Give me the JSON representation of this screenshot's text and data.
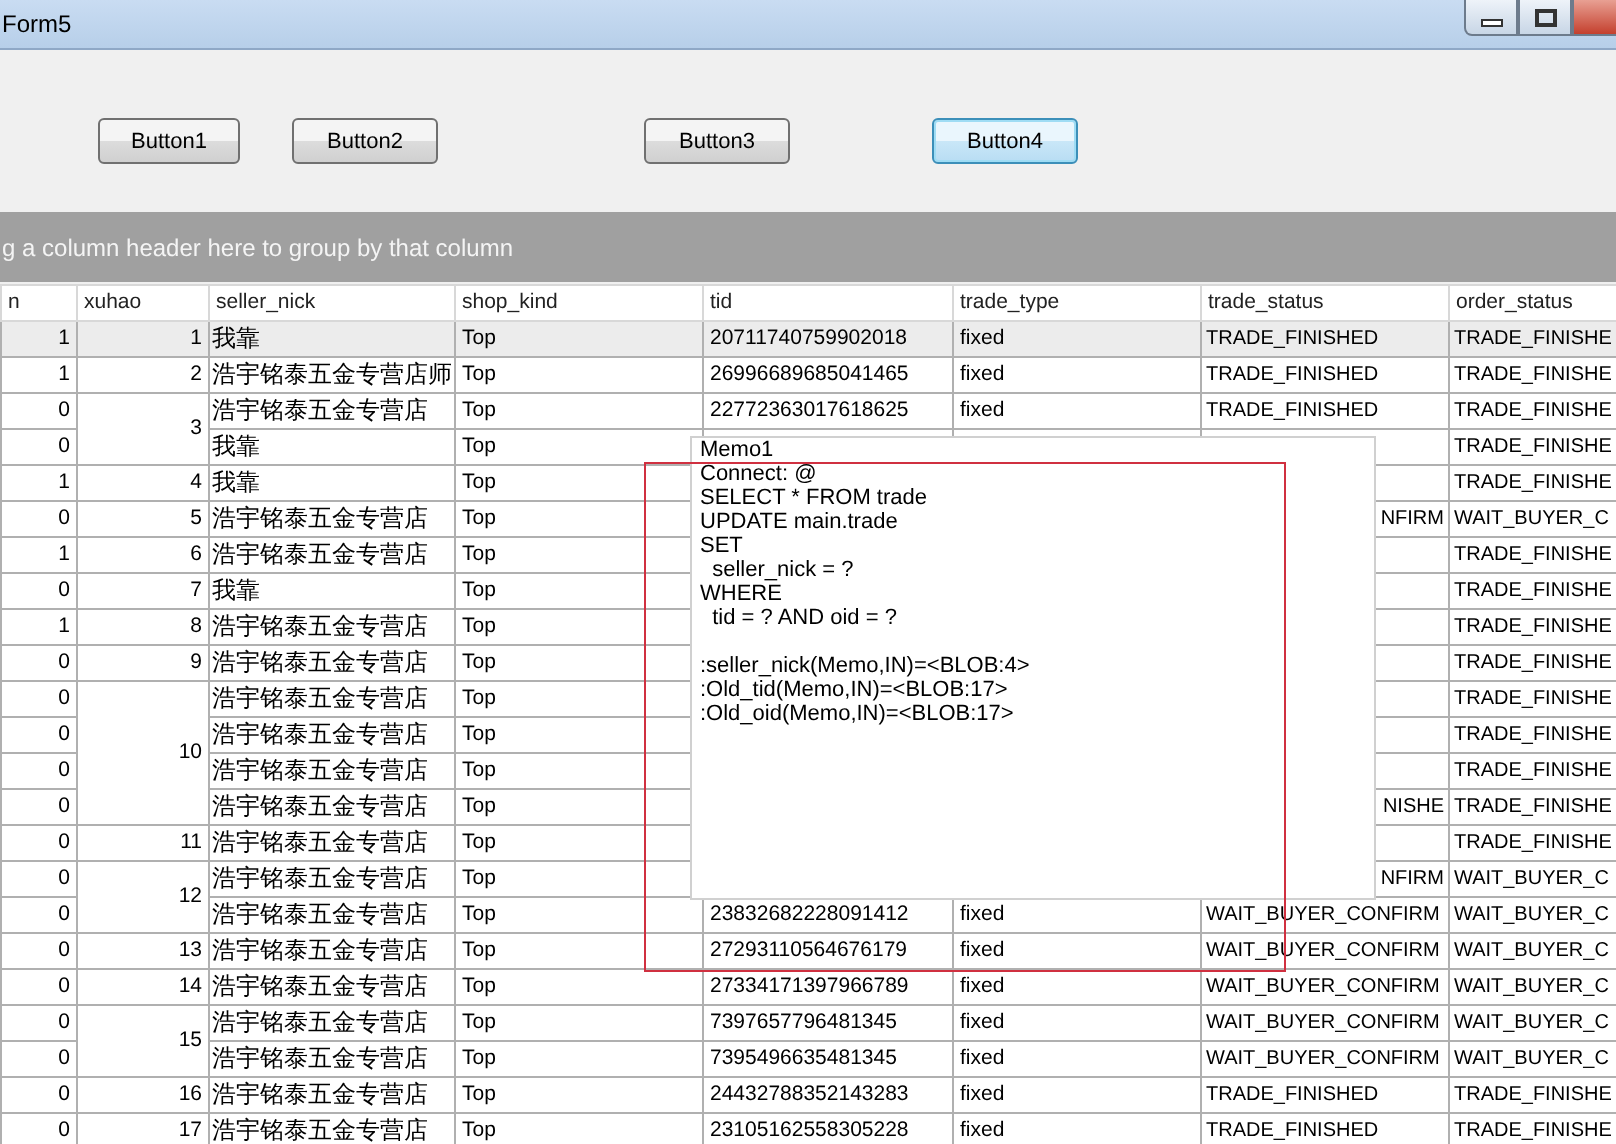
{
  "window": {
    "title": "Form5"
  },
  "buttons": [
    {
      "label": "Button1",
      "focused": false
    },
    {
      "label": "Button2",
      "focused": false
    },
    {
      "label": "Button3",
      "focused": false
    },
    {
      "label": "Button4",
      "focused": true
    }
  ],
  "group_panel": {
    "hint": "g a column header here to group by that column"
  },
  "table": {
    "columns": [
      "n",
      "xuhao",
      "seller_nick",
      "shop_kind",
      "tid",
      "trade_type",
      "trade_status",
      "order_status"
    ],
    "groups": [
      {
        "xuhao": "1",
        "rows": [
          {
            "n": "1",
            "seller_nick": "我靠",
            "shop_kind": "Top",
            "tid": "20711740759902018",
            "trade_type": "fixed",
            "trade_status": "TRADE_FINISHED",
            "status_clipped": false,
            "order_status": "TRADE_FINISHE",
            "selected": true
          }
        ]
      },
      {
        "xuhao": "2",
        "rows": [
          {
            "n": "1",
            "seller_nick": "浩宇铭泰五金专营店师",
            "shop_kind": "Top",
            "tid": "26996689685041465",
            "trade_type": "fixed",
            "trade_status": "TRADE_FINISHED",
            "status_clipped": false,
            "order_status": "TRADE_FINISHE",
            "selected": false
          }
        ]
      },
      {
        "xuhao": "3",
        "rows": [
          {
            "n": "0",
            "seller_nick": "浩宇铭泰五金专营店",
            "shop_kind": "Top",
            "tid": "22772363017618625",
            "trade_type": "fixed",
            "trade_status": "TRADE_FINISHED",
            "status_clipped": false,
            "order_status": "TRADE_FINISHE",
            "selected": false
          },
          {
            "n": "0",
            "seller_nick": "我靠",
            "shop_kind": "Top",
            "order_status": "TRADE_FINISHE",
            "selected": false
          }
        ]
      },
      {
        "xuhao": "4",
        "rows": [
          {
            "n": "1",
            "seller_nick": "我靠",
            "shop_kind": "Top",
            "order_status": "TRADE_FINISHE",
            "selected": false
          }
        ]
      },
      {
        "xuhao": "5",
        "rows": [
          {
            "n": "0",
            "seller_nick": "浩宇铭泰五金专营店",
            "shop_kind": "Top",
            "trade_status": "NFIRM",
            "status_clipped": true,
            "order_status": "WAIT_BUYER_C",
            "selected": false
          }
        ]
      },
      {
        "xuhao": "6",
        "rows": [
          {
            "n": "1",
            "seller_nick": "浩宇铭泰五金专营店",
            "shop_kind": "Top",
            "order_status": "TRADE_FINISHE",
            "selected": false
          }
        ]
      },
      {
        "xuhao": "7",
        "rows": [
          {
            "n": "0",
            "seller_nick": "我靠",
            "shop_kind": "Top",
            "order_status": "TRADE_FINISHE",
            "selected": false
          }
        ]
      },
      {
        "xuhao": "8",
        "rows": [
          {
            "n": "1",
            "seller_nick": "浩宇铭泰五金专营店",
            "shop_kind": "Top",
            "order_status": "TRADE_FINISHE",
            "selected": false
          }
        ]
      },
      {
        "xuhao": "9",
        "rows": [
          {
            "n": "0",
            "seller_nick": "浩宇铭泰五金专营店",
            "shop_kind": "Top",
            "order_status": "TRADE_FINISHE",
            "selected": false
          }
        ]
      },
      {
        "xuhao": "10",
        "rows": [
          {
            "n": "0",
            "seller_nick": "浩宇铭泰五金专营店",
            "shop_kind": "Top",
            "order_status": "TRADE_FINISHE",
            "selected": false
          },
          {
            "n": "0",
            "seller_nick": "浩宇铭泰五金专营店",
            "shop_kind": "Top",
            "order_status": "TRADE_FINISHE",
            "selected": false
          },
          {
            "n": "0",
            "seller_nick": "浩宇铭泰五金专营店",
            "shop_kind": "Top",
            "order_status": "TRADE_FINISHE",
            "selected": false
          },
          {
            "n": "0",
            "seller_nick": "浩宇铭泰五金专营店",
            "shop_kind": "Top",
            "trade_status": "NISHE",
            "status_clipped": true,
            "order_status": "TRADE_FINISHE",
            "selected": false
          }
        ]
      },
      {
        "xuhao": "11",
        "rows": [
          {
            "n": "0",
            "seller_nick": "浩宇铭泰五金专营店",
            "shop_kind": "Top",
            "order_status": "TRADE_FINISHE",
            "selected": false
          }
        ]
      },
      {
        "xuhao": "12",
        "rows": [
          {
            "n": "0",
            "seller_nick": "浩宇铭泰五金专营店",
            "shop_kind": "Top",
            "trade_status": "NFIRM",
            "status_clipped": true,
            "order_status": "WAIT_BUYER_C",
            "selected": false
          },
          {
            "n": "0",
            "seller_nick": "浩宇铭泰五金专营店",
            "shop_kind": "Top",
            "tid": "23832682228091412",
            "trade_type": "fixed",
            "trade_status": "WAIT_BUYER_CONFIRM",
            "status_clipped": false,
            "order_status": "WAIT_BUYER_C",
            "selected": false
          }
        ]
      },
      {
        "xuhao": "13",
        "rows": [
          {
            "n": "0",
            "seller_nick": "浩宇铭泰五金专营店",
            "shop_kind": "Top",
            "tid": "27293110564676179",
            "trade_type": "fixed",
            "trade_status": "WAIT_BUYER_CONFIRM",
            "status_clipped": false,
            "order_status": "WAIT_BUYER_C",
            "selected": false
          }
        ]
      },
      {
        "xuhao": "14",
        "rows": [
          {
            "n": "0",
            "seller_nick": "浩宇铭泰五金专营店",
            "shop_kind": "Top",
            "tid": "27334171397966789",
            "trade_type": "fixed",
            "trade_status": "WAIT_BUYER_CONFIRM",
            "status_clipped": false,
            "order_status": "WAIT_BUYER_C",
            "selected": false
          }
        ]
      },
      {
        "xuhao": "15",
        "rows": [
          {
            "n": "0",
            "seller_nick": "浩宇铭泰五金专营店",
            "shop_kind": "Top",
            "tid": "7397657796481345",
            "trade_type": "fixed",
            "trade_status": "WAIT_BUYER_CONFIRM",
            "status_clipped": false,
            "order_status": "WAIT_BUYER_C",
            "selected": false
          },
          {
            "n": "0",
            "seller_nick": "浩宇铭泰五金专营店",
            "shop_kind": "Top",
            "tid": "7395496635481345",
            "trade_type": "fixed",
            "trade_status": "WAIT_BUYER_CONFIRM",
            "status_clipped": false,
            "order_status": "WAIT_BUYER_C",
            "selected": false
          }
        ]
      },
      {
        "xuhao": "16",
        "rows": [
          {
            "n": "0",
            "seller_nick": "浩宇铭泰五金专营店",
            "shop_kind": "Top",
            "tid": "24432788352143283",
            "trade_type": "fixed",
            "trade_status": "TRADE_FINISHED",
            "status_clipped": false,
            "order_status": "TRADE_FINISHE",
            "selected": false
          }
        ]
      },
      {
        "xuhao": "17",
        "rows": [
          {
            "n": "0",
            "seller_nick": "浩宇铭泰五金专营店",
            "shop_kind": "Top",
            "tid": "23105162558305228",
            "trade_type": "fixed",
            "trade_status": "TRADE_FINISHED",
            "status_clipped": false,
            "order_status": "TRADE_FINISHE",
            "selected": false
          }
        ]
      }
    ]
  },
  "memo": {
    "title": "Memo1",
    "lines": [
      "Connect: @",
      "SELECT * FROM trade",
      "UPDATE main.trade",
      "SET",
      "  seller_nick = ?",
      "WHERE",
      "  tid = ? AND oid = ?"
    ],
    "params": [
      ":seller_nick(Memo,IN)=<BLOB:4>",
      ":Old_tid(Memo,IN)=<BLOB:17>",
      ":Old_oid(Memo,IN)=<BLOB:17>"
    ]
  }
}
